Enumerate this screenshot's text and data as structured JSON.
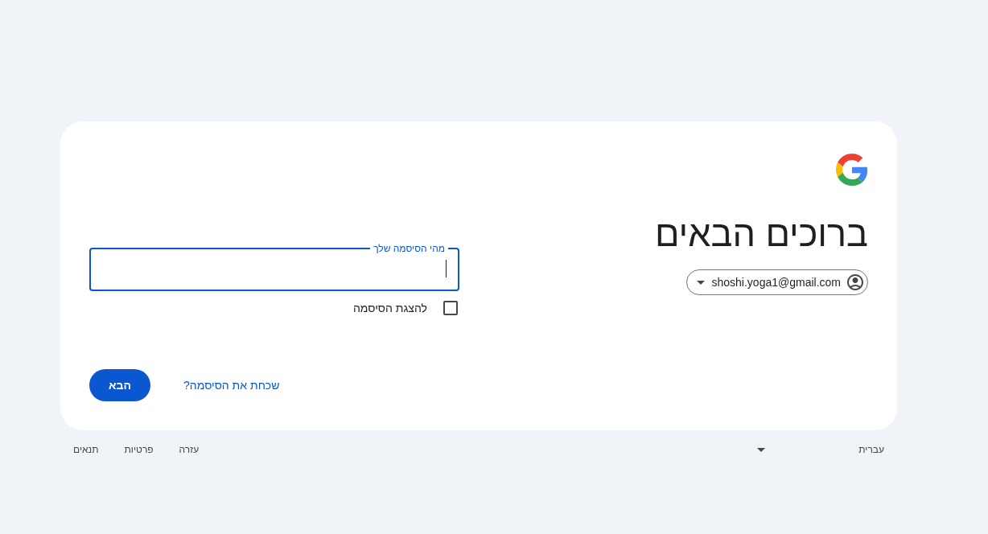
{
  "heading": "ברוכים הבאים",
  "account_chip": {
    "email": "shoshi.yoga1@gmail.com"
  },
  "password_field": {
    "label": "מהי הסיסמה שלך",
    "focused": true
  },
  "show_password": {
    "label": "להצגת הסיסמה",
    "checked": false
  },
  "actions": {
    "forgot_link": "שכחת את הסיסמה?",
    "next_button": "הבא"
  },
  "footer": {
    "language": "עברית",
    "links": [
      "עזרה",
      "פרטיות",
      "תנאים"
    ]
  }
}
